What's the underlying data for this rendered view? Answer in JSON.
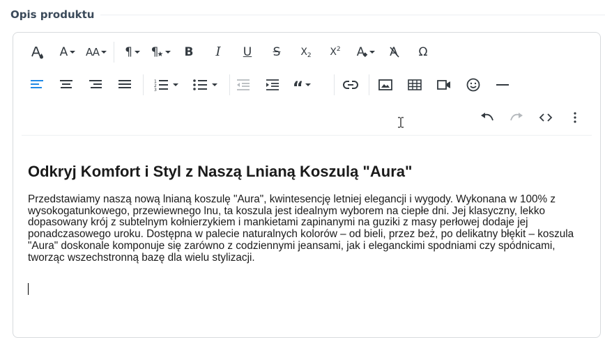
{
  "section": {
    "title": "Opis produktu"
  },
  "toolbar": {
    "row1": [
      {
        "name": "text-color-button",
        "icon": "text-color-icon"
      },
      {
        "name": "font-family-button",
        "label": "A",
        "icon": "font-family-icon"
      },
      {
        "name": "font-size-button",
        "label": "AA",
        "icon": "font-size-icon"
      },
      {
        "name": "paragraph-format-button",
        "label": "¶",
        "icon": "paragraph-icon"
      },
      {
        "name": "paragraph-style-button",
        "label": "¶",
        "icon": "paragraph-style-icon"
      },
      {
        "name": "bold-button",
        "label": "B",
        "icon": "bold-icon"
      },
      {
        "name": "italic-button",
        "label": "I",
        "icon": "italic-icon"
      },
      {
        "name": "underline-button",
        "label": "U",
        "icon": "underline-icon"
      },
      {
        "name": "strikethrough-button",
        "label": "S",
        "icon": "strikethrough-icon"
      },
      {
        "name": "subscript-button",
        "label": "X",
        "sub": "2",
        "icon": "subscript-icon"
      },
      {
        "name": "superscript-button",
        "label": "X",
        "sup": "2",
        "icon": "superscript-icon"
      },
      {
        "name": "inline-style-button",
        "label": "A",
        "icon": "inline-style-icon"
      },
      {
        "name": "clear-formatting-button",
        "label": "A",
        "icon": "clear-formatting-icon"
      },
      {
        "name": "special-characters-button",
        "label": "Ω",
        "icon": "omega-icon"
      }
    ],
    "row2": [
      {
        "name": "align-left-button",
        "icon": "align-left-icon",
        "active": true
      },
      {
        "name": "align-center-button",
        "icon": "align-center-icon"
      },
      {
        "name": "align-right-button",
        "icon": "align-right-icon"
      },
      {
        "name": "align-justify-button",
        "icon": "align-justify-icon"
      },
      {
        "name": "ordered-list-button",
        "icon": "ordered-list-icon"
      },
      {
        "name": "unordered-list-button",
        "icon": "unordered-list-icon"
      },
      {
        "name": "outdent-button",
        "icon": "outdent-icon",
        "disabled": true
      },
      {
        "name": "indent-button",
        "icon": "indent-icon"
      },
      {
        "name": "quote-button",
        "icon": "quote-icon"
      },
      {
        "name": "insert-link-button",
        "icon": "link-icon"
      },
      {
        "name": "insert-image-button",
        "icon": "image-icon"
      },
      {
        "name": "insert-table-button",
        "icon": "table-icon"
      },
      {
        "name": "insert-video-button",
        "icon": "video-icon"
      },
      {
        "name": "emoticons-button",
        "icon": "emoji-icon"
      },
      {
        "name": "horizontal-line-button",
        "icon": "horizontal-line-icon"
      }
    ],
    "row3": [
      {
        "name": "undo-button",
        "icon": "undo-icon"
      },
      {
        "name": "redo-button",
        "icon": "redo-icon",
        "disabled": true
      },
      {
        "name": "code-view-button",
        "icon": "code-icon"
      },
      {
        "name": "more-options-button",
        "icon": "more-vertical-icon"
      }
    ],
    "colors": {
      "icon": "#333a40",
      "active": "#1e88e5",
      "disabled": "#b5b9bd"
    }
  },
  "content": {
    "heading": "Odkryj Komfort i Styl z Naszą Lnianą Koszulą \"Aura\"",
    "paragraph": "Przedstawiamy naszą nową lnianą koszulę \"Aura\", kwintesencję letniej elegancji i wygody. Wykonana w 100% z wysokogatunkowego, przewiewnego lnu, ta koszula jest idealnym wyborem na ciepłe dni. Jej klasyczny, lekko dopasowany krój z subtelnym kołnierzykiem i mankietami zapinanymi na guziki z masy perłowej dodaje jej ponadczasowego uroku. Dostępna w palecie naturalnych kolorów – od bieli, przez beż, po delikatny błękit – koszula \"Aura\" doskonale komponuje się zarówno z codziennymi jeansami, jak i eleganckimi spodniami czy spódnicami, tworząc wszechstronną bazę dla wielu stylizacji."
  }
}
